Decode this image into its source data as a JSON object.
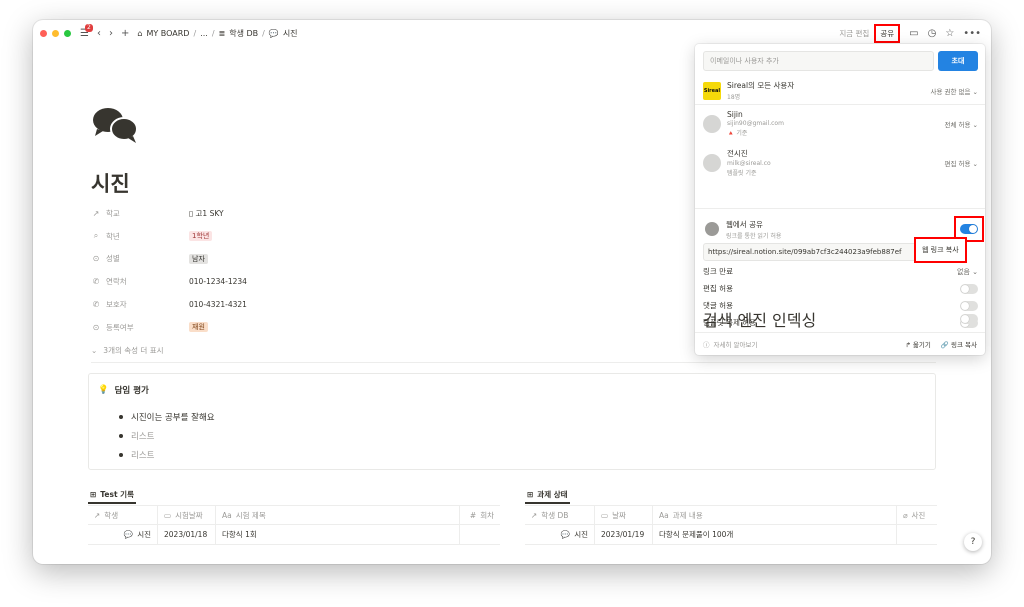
{
  "topbar": {
    "badge": "2",
    "back_icon": "chevron-left-icon",
    "forward_icon": "chevron-right-icon",
    "new_icon": "plus-icon",
    "breadcrumbs": [
      "MY BOARD",
      "...",
      "학생 DB",
      "시진"
    ],
    "edited_text": "지금 편집",
    "share_label": "공유"
  },
  "page": {
    "title": "시진",
    "properties": [
      {
        "name": "학교",
        "icon": "↗",
        "value": "고1 SKY",
        "type": "link"
      },
      {
        "name": "학년",
        "icon": "⌕",
        "value": "1학년",
        "type": "tag-red"
      },
      {
        "name": "성별",
        "icon": "⊙",
        "value": "남자",
        "type": "tag-gray"
      },
      {
        "name": "연락처",
        "icon": "✆",
        "value": "010-1234-1234",
        "type": "text"
      },
      {
        "name": "보호자",
        "icon": "✆",
        "value": "010-4321-4321",
        "type": "text"
      },
      {
        "name": "등록여부",
        "icon": "⊙",
        "value": "재원",
        "type": "tag-orange"
      }
    ],
    "more_props": "3개의 속성 더 표시"
  },
  "callout": {
    "title": "담임 평가",
    "items": [
      "시진이는 공부를 잘해요",
      "리스트",
      "리스트"
    ]
  },
  "table1": {
    "title": "Test 기록",
    "headers": [
      "학생",
      "시험날짜",
      "시험 제목",
      "회차"
    ],
    "row": [
      "시진",
      "2023/01/18",
      "다항식 1회",
      ""
    ]
  },
  "table2": {
    "title": "과제 상태",
    "headers": [
      "학생 DB",
      "날짜",
      "과제 내용",
      "사진"
    ],
    "row": [
      "시진",
      "2023/01/19",
      "다항식 문제풀이 100개",
      ""
    ]
  },
  "share": {
    "invite_placeholder": "이메일이나 사용자 추가",
    "invite_button": "초대",
    "members": [
      {
        "name": "Sireal의 모든 사용자",
        "sub1": "18명",
        "sub2": "",
        "perm": "사용 권한 없음 ⌄"
      },
      {
        "name": "Sijin",
        "sub1": "sijin90@gmail.com",
        "sub2": "🔺 기준",
        "perm": "전체 허용 ⌄"
      },
      {
        "name": "전시진",
        "sub1": "milk@sireal.co",
        "sub2": "템플릿 기준",
        "perm": "편집 허용 ⌄"
      }
    ],
    "web_title": "웹에서 공유",
    "web_sub": "링크를 통한 읽기 허용",
    "web_link": "https://sireal.notion.site/099ab7cf3c244023a9feb887ef",
    "copy_web_link": "웹 링크 복사",
    "options": [
      {
        "label": "링크 만료",
        "value": "없음 ⌄"
      },
      {
        "label": "편집 허용"
      },
      {
        "label": "댓글 허용"
      },
      {
        "label": "템플릿 복제 허용"
      },
      {
        "label": "검색 엔진 인덱싱"
      }
    ],
    "learn_more": "자세히 알아보기",
    "move_label": "옮기기",
    "copy_link": "링크 복사"
  }
}
